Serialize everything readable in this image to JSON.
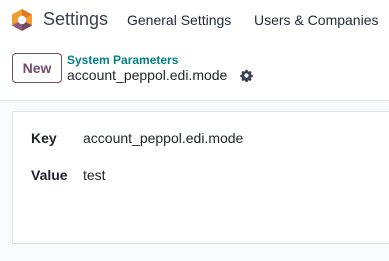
{
  "app": {
    "name": "Settings",
    "logo_icon": "odoo-settings-logo-icon"
  },
  "menu": {
    "items": [
      {
        "label": "General Settings"
      },
      {
        "label": "Users & Companies"
      }
    ]
  },
  "control_panel": {
    "new_button_label": "New",
    "breadcrumb": "System Parameters",
    "record_title": "account_peppol.edi.mode",
    "actions_icon": "gear-icon"
  },
  "form": {
    "fields": [
      {
        "label": "Key",
        "value": "account_peppol.edi.mode"
      },
      {
        "label": "Value",
        "value": "test"
      }
    ]
  },
  "colors": {
    "brand": "#714b67",
    "breadcrumb_link": "#017e84",
    "logo_orange": "#f39c32",
    "logo_purple": "#714b67"
  }
}
